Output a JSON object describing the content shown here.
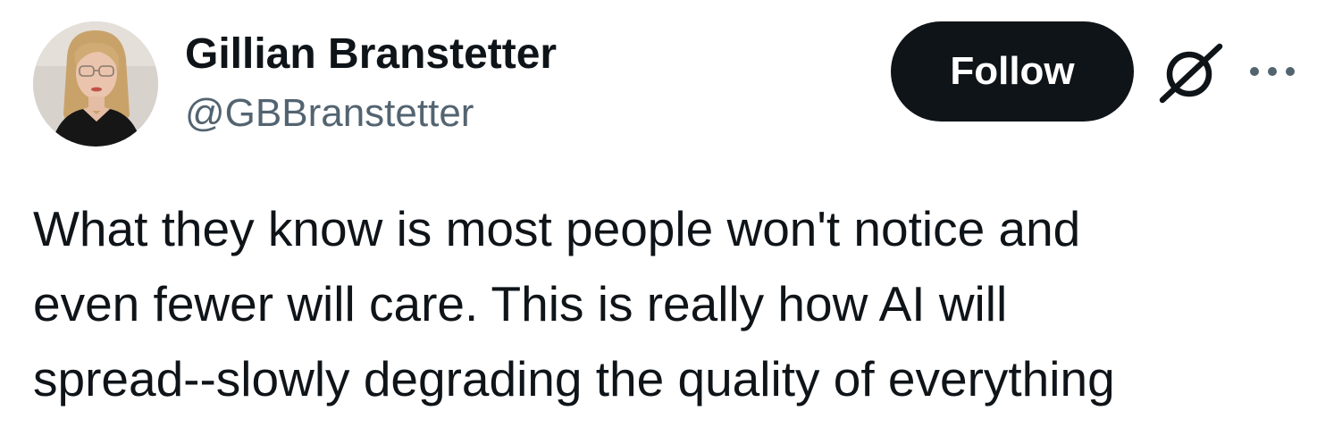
{
  "author": {
    "display_name": "Gillian Branstetter",
    "handle": "@GBBranstetter",
    "avatar": "profile-photo"
  },
  "actions": {
    "follow_label": "Follow",
    "grok_icon": "grok-slash-icon",
    "more_icon": "more-dots-icon"
  },
  "tweet": {
    "text": "What they know is most people won't notice and\neven fewer will care. This is really how AI will\nspread--slowly degrading the quality of everything"
  },
  "colors": {
    "text_primary": "#0f1419",
    "text_secondary": "#536471",
    "button_bg": "#0f1419",
    "button_text": "#ffffff",
    "background": "#ffffff"
  }
}
